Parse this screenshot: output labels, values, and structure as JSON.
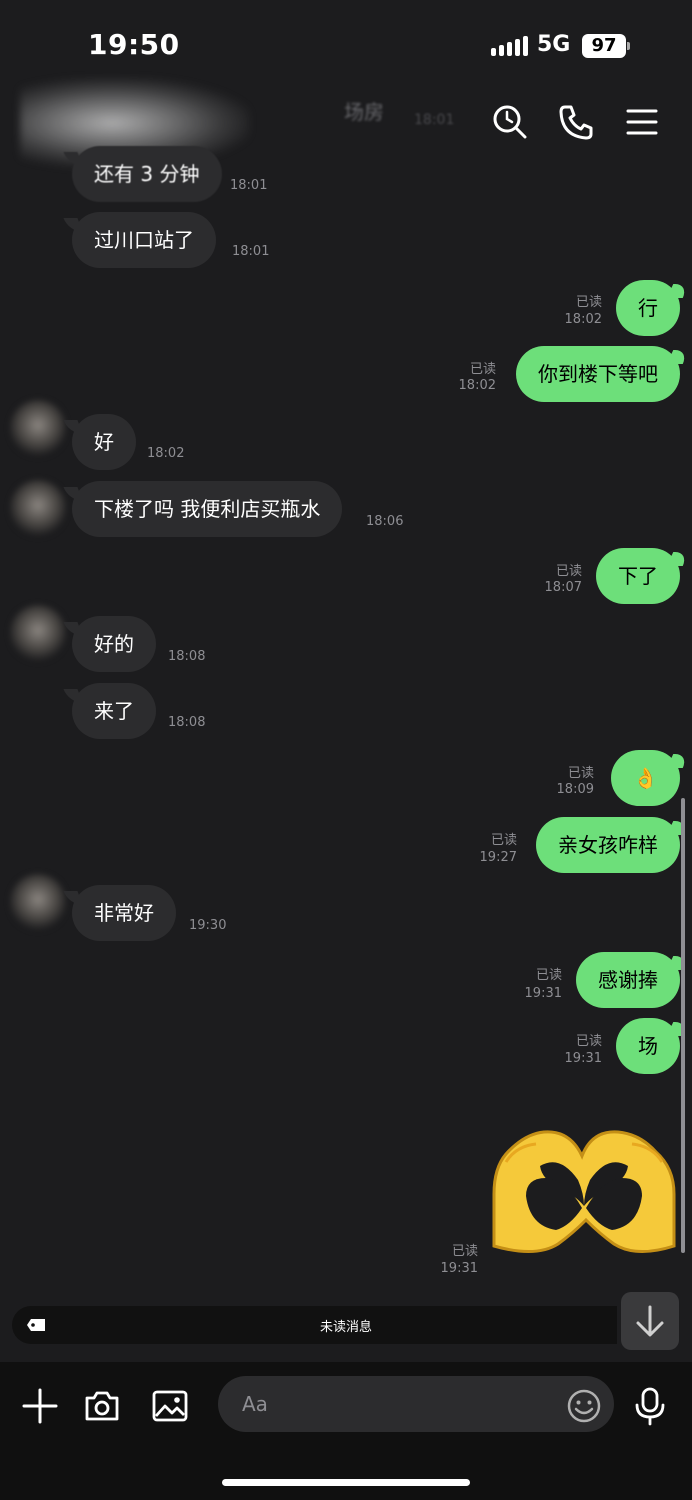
{
  "status_bar": {
    "time": "19:50",
    "network": "5G",
    "battery": "97"
  },
  "header": {
    "contact_name_suffix": "场房",
    "partial_time": "18:01"
  },
  "messages": [
    {
      "dir": "in",
      "text": "还有 3 分钟",
      "time": "18:01"
    },
    {
      "dir": "in",
      "text": "过川口站了",
      "time": "18:01"
    },
    {
      "dir": "out",
      "text": "行",
      "read": "已读",
      "time": "18:02"
    },
    {
      "dir": "out",
      "text": "你到楼下等吧",
      "read": "已读",
      "time": "18:02"
    },
    {
      "dir": "in",
      "text": "好",
      "time": "18:02"
    },
    {
      "dir": "in",
      "text": "下楼了吗 我便利店买瓶水",
      "time": "18:06"
    },
    {
      "dir": "out",
      "text": "下了",
      "read": "已读",
      "time": "18:07"
    },
    {
      "dir": "in",
      "text": "好的",
      "time": "18:08"
    },
    {
      "dir": "in",
      "text": "来了",
      "time": "18:08"
    },
    {
      "dir": "out",
      "text": "👌",
      "read": "已读",
      "time": "18:09"
    },
    {
      "dir": "out",
      "text": "亲女孩咋样",
      "read": "已读",
      "time": "19:27"
    },
    {
      "dir": "in",
      "text": "非常好",
      "time": "19:30"
    },
    {
      "dir": "out",
      "text": "感谢捧",
      "read": "已读",
      "time": "19:31"
    },
    {
      "dir": "out",
      "text": "场",
      "read": "已读",
      "time": "19:31"
    },
    {
      "dir": "out",
      "sticker": "heart-hands",
      "read": "已读",
      "time": "19:31"
    }
  ],
  "unread_bar": {
    "label": "未读消息"
  },
  "input": {
    "placeholder": "Aa"
  },
  "colors": {
    "background": "#1c1c1e",
    "outgoing_bubble": "#6ddf7a",
    "incoming_bubble": "#2c2c2e",
    "meta_text": "#8e8e93"
  }
}
